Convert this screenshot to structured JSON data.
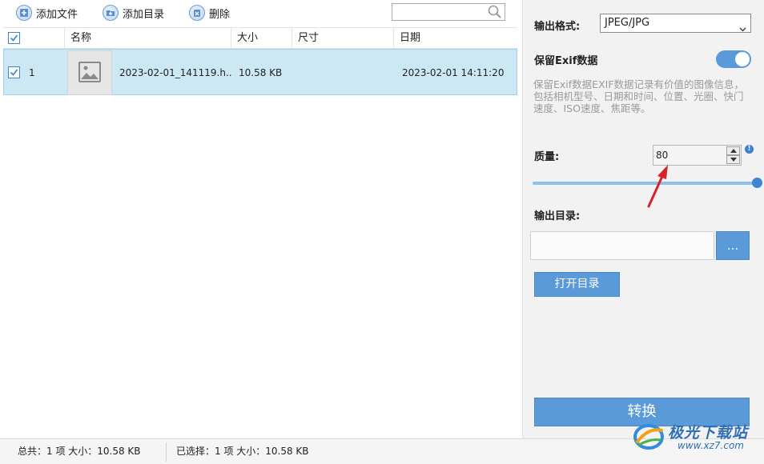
{
  "toolbar": {
    "add_file_label": "添加文件",
    "add_dir_label": "添加目录",
    "delete_label": "删除",
    "search_placeholder": ""
  },
  "table": {
    "columns": [
      "名称",
      "大小",
      "尺寸",
      "日期"
    ],
    "rows": [
      {
        "index": "1",
        "name": "2023-02-01_141119.h...",
        "size": "10.58 KB",
        "dimensions": "",
        "date": "2023-02-01 14:11:20",
        "checked": true
      }
    ]
  },
  "settings": {
    "format_label": "输出格式:",
    "format_value": "JPEG/JPG",
    "exif_label": "保留Exif数据",
    "exif_enabled": true,
    "exif_desc": "保留Exif数据EXIF数据记录有价值的图像信息，包括相机型号、日期和时间、位置、光圈、快门速度、ISO速度、焦距等。",
    "quality_label": "质量:",
    "quality_value": "80",
    "quality_slider_fraction": 1.0,
    "info_glyph": "!",
    "output_dir_label": "输出目录:",
    "output_dir_value": "",
    "browse_label": "...",
    "open_dir_label": "打开目录",
    "convert_label": "转换"
  },
  "status": {
    "total": "总共：1 项 大小：10.58 KB",
    "selected": "已选择：1 项 大小：10.58 KB"
  },
  "watermark": {
    "line1": "极光下载站",
    "line2": "www.xz7.com"
  },
  "colors": {
    "accent": "#5b9ad8",
    "selected_row": "#cce8f4",
    "annotation_arrow": "#d8232a"
  }
}
